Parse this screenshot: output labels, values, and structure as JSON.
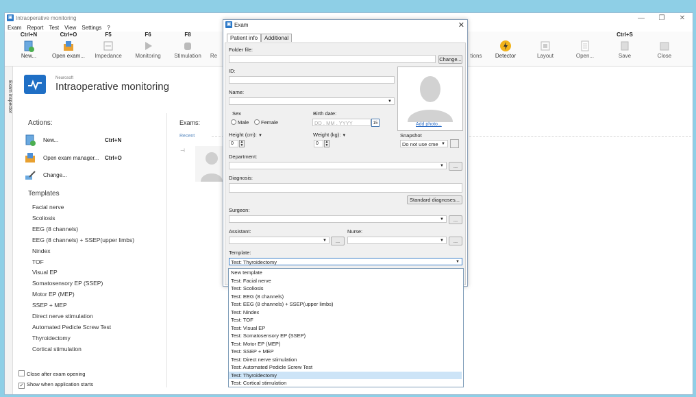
{
  "window": {
    "title": "Intraoperative monitoring"
  },
  "menu": [
    "Exam",
    "Report",
    "Test",
    "View",
    "Settings",
    "?"
  ],
  "toolbar": [
    {
      "shortcut": "Ctrl+N",
      "label": "New..."
    },
    {
      "shortcut": "Ctrl+O",
      "label": "Open exam..."
    },
    {
      "shortcut": "F5",
      "label": "Impedance"
    },
    {
      "shortcut": "F6",
      "label": "Monitoring"
    },
    {
      "shortcut": "F8",
      "label": "Stimulation"
    },
    {
      "shortcut": "",
      "label": "Re"
    },
    {
      "shortcut": "",
      "label": "tions"
    },
    {
      "shortcut": "",
      "label": "Detector"
    },
    {
      "shortcut": "",
      "label": "Layout"
    },
    {
      "shortcut": "",
      "label": "Open..."
    },
    {
      "shortcut": "Ctrl+S",
      "label": "Save"
    },
    {
      "shortcut": "",
      "label": "Close"
    }
  ],
  "sidebar": {
    "tab_label": "Exam inspector"
  },
  "brand": {
    "company": "Neurosoft",
    "title": "Intraoperative monitoring"
  },
  "actions": {
    "heading": "Actions:",
    "items": [
      {
        "label": "New...",
        "shortcut": "Ctrl+N"
      },
      {
        "label": "Open exam manager...",
        "shortcut": "Ctrl+O"
      },
      {
        "label": "Change...",
        "shortcut": ""
      }
    ]
  },
  "templates": {
    "heading": "Templates",
    "items": [
      "Facial nerve",
      "Scoliosis",
      "EEG (8 channels)",
      "EEG (8 channels) + SSEP(upper limbs)",
      "Nindex",
      "TOF",
      "Visual EP",
      "Somatosensory EP (SSEP)",
      "Motor EP (MEP)",
      "SSEP + MEP",
      "Direct nerve stimulation",
      "Automated Pedicle Screw Test",
      "Thyroidectomy",
      "Cortical stimulation"
    ]
  },
  "exams": {
    "heading": "Exams:",
    "recent_label": "Recent"
  },
  "options": {
    "close_after_open": "Close after exam opening",
    "show_on_start": "Show when application starts"
  },
  "dialog": {
    "title": "Exam",
    "tabs": [
      "Patient info",
      "Additional"
    ],
    "folder_label": "Folder file:",
    "change_button": "Change...",
    "id_label": "ID:",
    "name_label": "Name:",
    "sex_label": "Sex",
    "sex_male": "Male",
    "sex_female": "Female",
    "birth_label": "Birth date:",
    "birth_dd": "DD",
    "birth_mm": "MM",
    "birth_yyyy": "YYYY",
    "calendar_day": "15",
    "add_photo": "Add photo...",
    "height_label": "Height (cm):",
    "height_value": "0",
    "weight_label": "Weight (kg):",
    "weight_value": "0",
    "snapshot_label": "Snapshot",
    "snapshot_value": "Do not use cme",
    "department_label": "Department:",
    "diagnosis_label": "Diagnosis:",
    "std_diag_button": "Standard diagnoses...",
    "surgeon_label": "Surgeon:",
    "assistant_label": "Assistant:",
    "nurse_label": "Nurse:",
    "template_label": "Template:",
    "template_value": "Test: Thyroidectomy",
    "ellipsis": "..."
  },
  "dropdown": {
    "selected_index": 13,
    "items": [
      "New template",
      "Test: Facial nerve",
      "Test: Scoliosis",
      "Test: EEG (8 channels)",
      "Test: EEG (8 channels) + SSEP(upper limbs)",
      "Test: Nindex",
      "Test: TOF",
      "Test: Visual EP",
      "Test: Somatosensory EP (SSEP)",
      "Test: Motor EP (MEP)",
      "Test: SSEP + MEP",
      "Test: Direct nerve stimulation",
      "Test: Automated Pedicle Screw Test",
      "Test: Thyroidectomy",
      "Test: Cortical stimulation"
    ]
  }
}
